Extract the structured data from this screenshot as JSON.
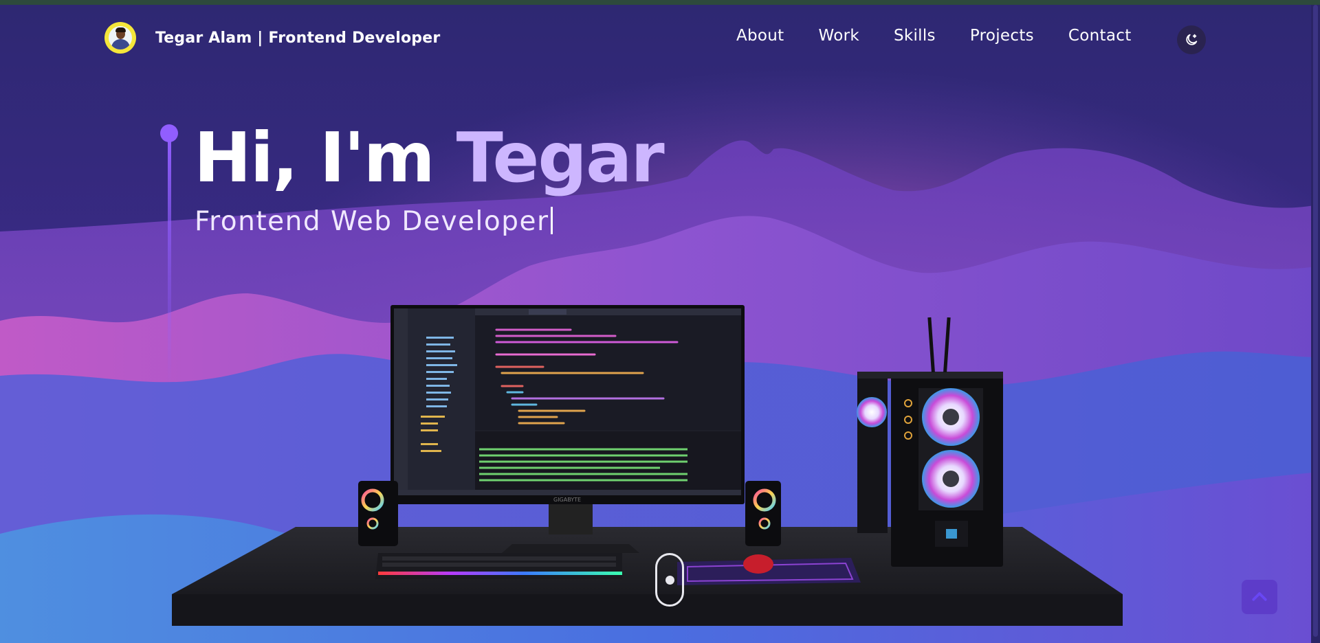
{
  "brand": {
    "name": "Tegar Alam | Frontend Developer"
  },
  "nav": {
    "items": [
      "About",
      "Work",
      "Skills",
      "Projects",
      "Contact"
    ]
  },
  "hero": {
    "greeting": "Hi, I'm ",
    "name": "Tegar",
    "subtitle": "Frontend Web Developer"
  },
  "colors": {
    "accent": "#915eff",
    "name_highlight": "#cdb6ff",
    "background": "#2c2570"
  },
  "icons": {
    "theme_toggle": "moon-icon",
    "back_to_top": "chevron-up-icon",
    "scroll": "mouse-scroll-icon"
  },
  "monitor": {
    "brand": "GIGABYTE"
  }
}
